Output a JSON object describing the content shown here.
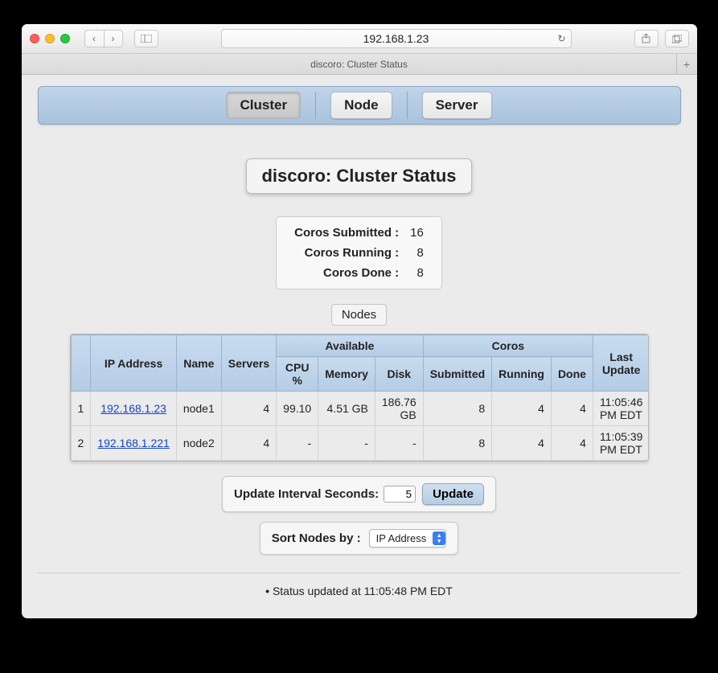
{
  "browser": {
    "url": "192.168.1.23",
    "tab_title": "discoro: Cluster Status"
  },
  "nav": {
    "tabs": [
      {
        "label": "Cluster",
        "active": true
      },
      {
        "label": "Node",
        "active": false
      },
      {
        "label": "Server",
        "active": false
      }
    ]
  },
  "page_title": "discoro: Cluster Status",
  "stats": {
    "submitted_label": "Coros Submitted :",
    "submitted": "16",
    "running_label": "Coros Running :",
    "running": "8",
    "done_label": "Coros Done :",
    "done": "8"
  },
  "nodes_button_label": "Nodes",
  "table": {
    "headers": {
      "ip": "IP Address",
      "name": "Name",
      "servers": "Servers",
      "available": "Available",
      "cpu": "CPU %",
      "memory": "Memory",
      "disk": "Disk",
      "coros": "Coros",
      "submitted": "Submitted",
      "running": "Running",
      "done": "Done",
      "last_update": "Last Update"
    },
    "rows": [
      {
        "n": "1",
        "ip": "192.168.1.23",
        "name": "node1",
        "servers": "4",
        "cpu": "99.10",
        "memory": "4.51 GB",
        "disk": "186.76 GB",
        "submitted": "8",
        "running": "4",
        "done": "4",
        "last_update": "11:05:46 PM EDT"
      },
      {
        "n": "2",
        "ip": "192.168.1.221",
        "name": "node2",
        "servers": "4",
        "cpu": "-",
        "memory": "-",
        "disk": "-",
        "submitted": "8",
        "running": "4",
        "done": "4",
        "last_update": "11:05:39 PM EDT"
      }
    ]
  },
  "update_interval": {
    "label": "Update Interval Seconds:",
    "value": "5",
    "button": "Update"
  },
  "sort": {
    "label": "Sort Nodes by :",
    "selected": "IP Address"
  },
  "status_log": "Status updated at 11:05:48 PM EDT"
}
